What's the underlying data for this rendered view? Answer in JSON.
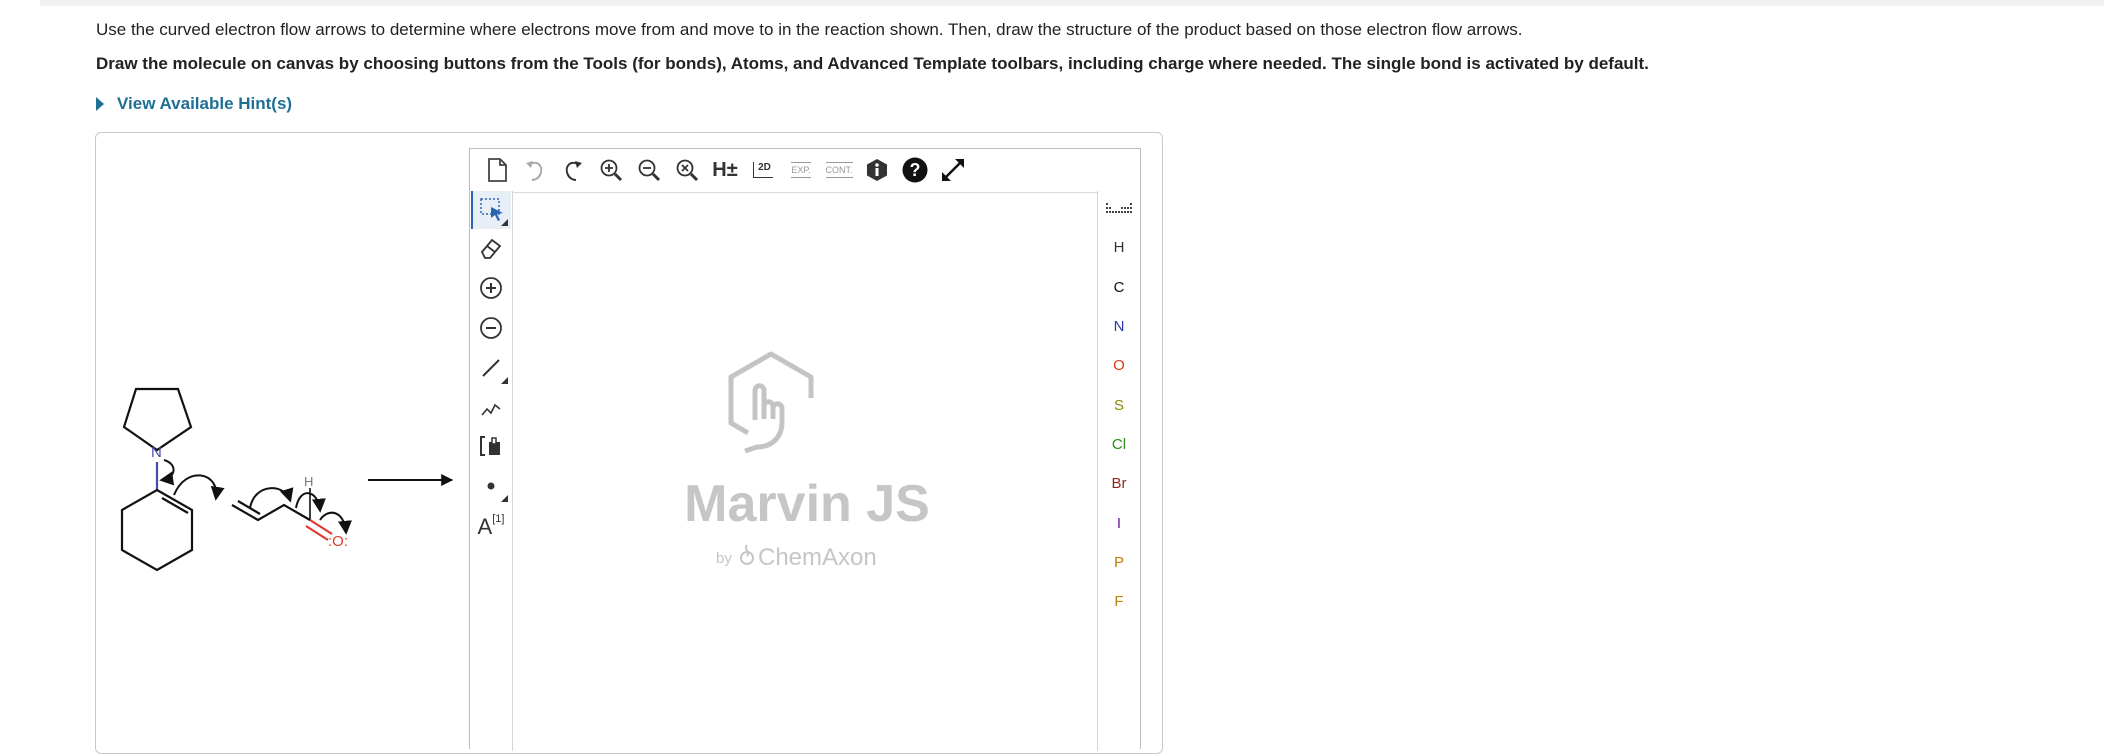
{
  "instructions": {
    "line1": "Use the curved electron flow arrows to determine where electrons move from and move to in the reaction shown. Then, draw the structure of the product based on those electron flow arrows.",
    "line2": "Draw the molecule on canvas by choosing buttons from the Tools (for bonds), Atoms, and Advanced Template toolbars, including charge where needed.  The single bond is activated by default."
  },
  "hint": {
    "label": "View Available Hint(s)"
  },
  "reaction": {
    "n_label": "N",
    "h_label": "H",
    "o_label": ":O:",
    "n_color": "#4a4aa8",
    "o_color": "#e03a2f"
  },
  "editor": {
    "top_tools": [
      {
        "name": "new-document-icon"
      },
      {
        "name": "undo-icon"
      },
      {
        "name": "redo-icon"
      },
      {
        "name": "zoom-in-icon"
      },
      {
        "name": "zoom-out-icon"
      },
      {
        "name": "zoom-reset-icon"
      },
      {
        "name": "hydrogen-toggle-icon",
        "label": "H±"
      },
      {
        "name": "clean-2d-icon",
        "label": "2D"
      },
      {
        "name": "expand-icon",
        "label": "EXP."
      },
      {
        "name": "contract-icon",
        "label": "CONT."
      },
      {
        "name": "info-icon"
      },
      {
        "name": "help-icon"
      },
      {
        "name": "fullscreen-icon"
      }
    ],
    "left_tools": [
      {
        "name": "select-icon"
      },
      {
        "name": "eraser-icon"
      },
      {
        "name": "plus-charge-icon"
      },
      {
        "name": "minus-charge-icon"
      },
      {
        "name": "single-bond-icon"
      },
      {
        "name": "chain-icon"
      },
      {
        "name": "bracket-icon"
      },
      {
        "name": "lone-pair-icon"
      },
      {
        "name": "text-icon",
        "label": "A",
        "sup": "[1]"
      }
    ],
    "atoms": [
      {
        "symbol": "H",
        "color": "#333333"
      },
      {
        "symbol": "C",
        "color": "#111111"
      },
      {
        "symbol": "N",
        "color": "#2b3aa8"
      },
      {
        "symbol": "O",
        "color": "#d63a1a"
      },
      {
        "symbol": "S",
        "color": "#8a8a00"
      },
      {
        "symbol": "Cl",
        "color": "#2e8b1e"
      },
      {
        "symbol": "Br",
        "color": "#8b2a1a"
      },
      {
        "symbol": "I",
        "color": "#6b1a9a"
      },
      {
        "symbol": "P",
        "color": "#c87a00"
      },
      {
        "symbol": "F",
        "color": "#b8860b"
      }
    ],
    "logo": {
      "title": "Marvin JS",
      "by": "by",
      "brand": "ChemAxon"
    }
  }
}
